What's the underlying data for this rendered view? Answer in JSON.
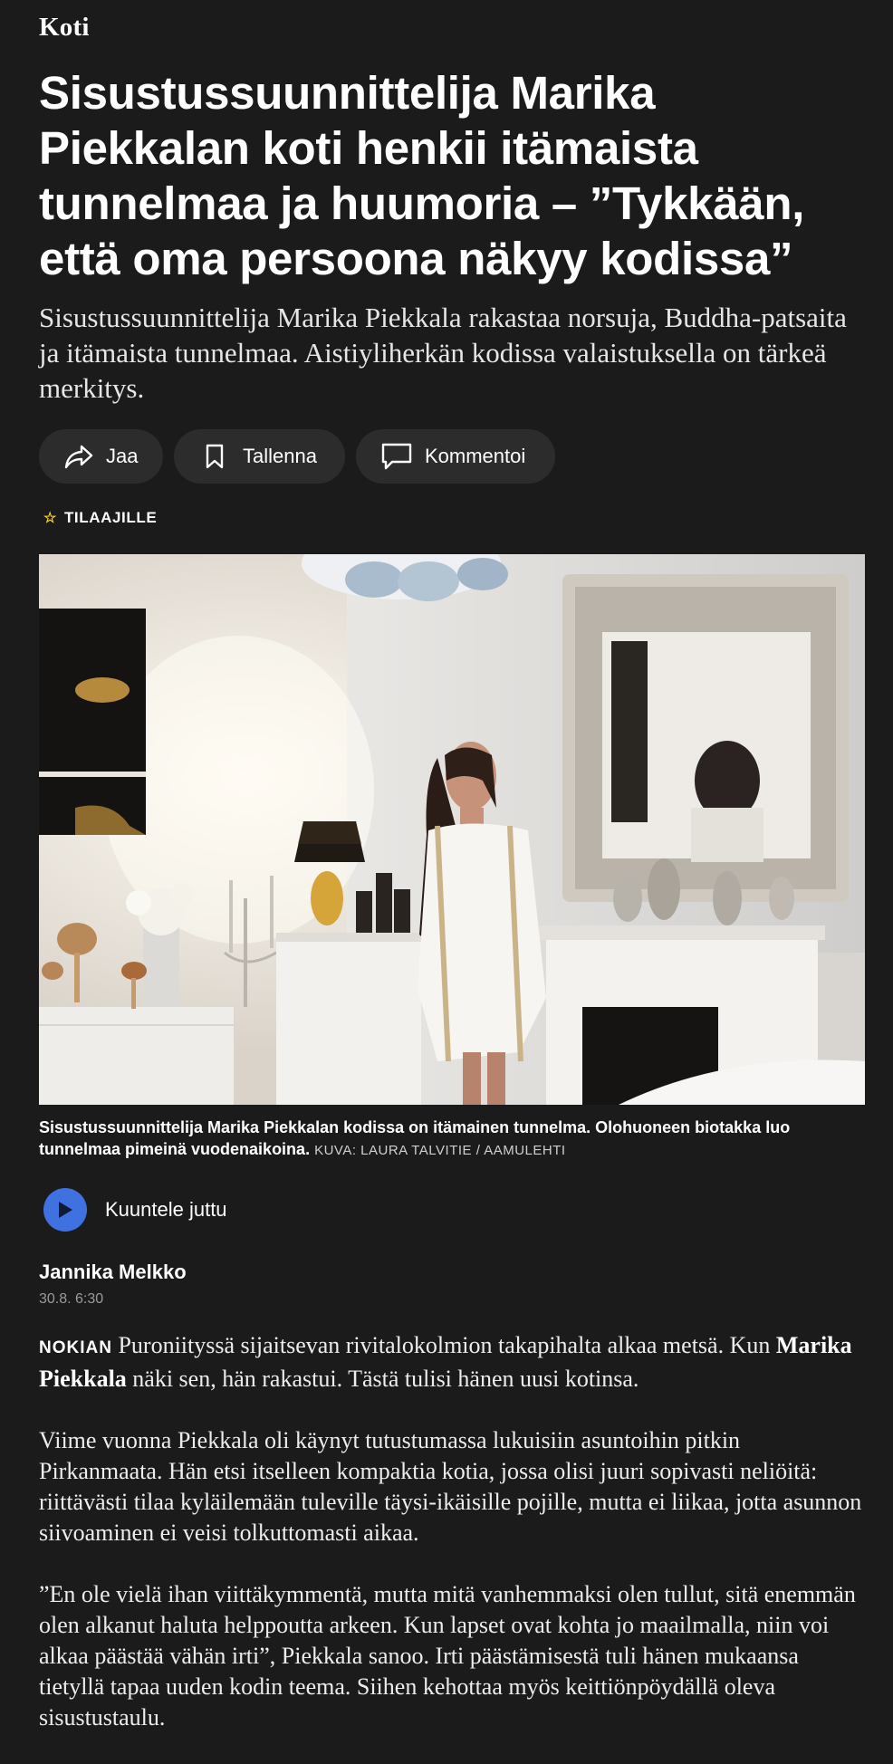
{
  "section": "Koti",
  "headline": "Sisustussuunnittelija Marika Piekkalan koti henkii itämaista tunnelmaa ja huumoria – ”Tykkään, että oma persoona näkyy kodissa”",
  "lead": "Sisustussuunnittelija Marika Piekkala rakastaa norsuja, Buddha-patsaita ja itämaista tunnelmaa. Aistiyliherkän kodissa valaistuksella on tärkeä merkitys.",
  "actions": {
    "share": {
      "label": "Jaa",
      "icon": "share-arrow-icon"
    },
    "save": {
      "label": "Tallenna",
      "icon": "bookmark-icon"
    },
    "comment": {
      "label": "Kommentoi",
      "icon": "comment-icon"
    }
  },
  "badge": {
    "label": "TILAAJILLE",
    "icon": "star-icon",
    "color": "#f2d33a"
  },
  "photo": {
    "caption": "Sisustussuunnittelija Marika Piekkalan kodissa on itämainen tunnelma. Olohuoneen biotakka luo tunnelmaa pimeinä vuodenaikoina.",
    "credit": "KUVA: LAURA TALVITIE / AAMULEHTI"
  },
  "listen": {
    "label": "Kuuntele juttu",
    "icon": "play-icon",
    "color": "#3f72e0"
  },
  "author": "Jannika Melkko",
  "date": "30.8. 6:30",
  "body": {
    "p1_dateline": "NOKIAN",
    "p1_a": " Puroniityssä sijaitsevan rivitalokolmion takapihalta alkaa metsä. Kun ",
    "p1_name": "Marika Piekkala",
    "p1_b": " näki sen, hän rakastui. Tästä tulisi hänen uusi kotinsa.",
    "p2": "Viime vuonna Piekkala oli käynyt tutustumassa lukuisiin asuntoihin pitkin Pirkanmaata. Hän etsi itselleen kompaktia kotia, jossa olisi juuri sopivasti neliöitä: riittävästi tilaa kyläilemään tuleville täysi-ikäisille pojille, mutta ei liikaa, jotta asunnon siivoaminen ei veisi tolkuttomasti aikaa.",
    "p3": "”En ole vielä ihan viittäkymmentä, mutta mitä vanhemmaksi olen tullut, sitä enemmän olen alkanut haluta helppoutta arkeen. Kun lapset ovat kohta jo maailmalla, niin voi alkaa päästää vähän irti”, Piekkala sanoo. Irti päästämisestä tuli hänen mukaansa tietyllä tapaa uuden kodin teema. Siihen kehottaa myös keittiönpöydällä oleva sisustustaulu."
  }
}
